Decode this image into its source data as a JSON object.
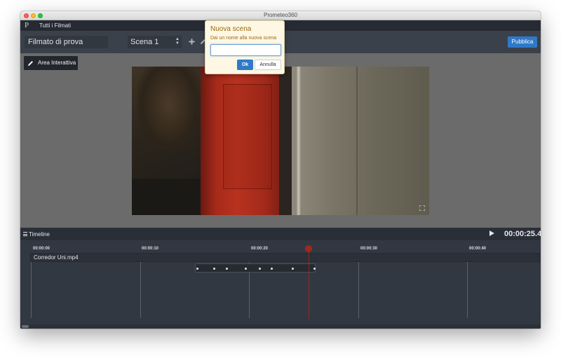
{
  "window": {
    "title": "Prometeo360"
  },
  "menubar": {
    "logo": "P",
    "all_films": "Tutti i Filmati"
  },
  "toolbar": {
    "film_title": "Filmato di prova",
    "scene_selected": "Scena 1",
    "add_icon": "plus-icon",
    "edit_icon": "pencil-icon",
    "delete_icon": "trash-icon",
    "publish_label": "Pubblica",
    "publish_color": "#2f79c8"
  },
  "stage": {
    "interactive_area_label": "Area Interattiva",
    "fullscreen_icon": "expand-icon"
  },
  "popover": {
    "title": "Nuova scena",
    "subtitle": "Dai un nome alla nuova scena",
    "input_value": "",
    "ok_label": "Ok",
    "cancel_label": "Annulla"
  },
  "timeline": {
    "label": "Timeline",
    "timecode": "00:00:25.4",
    "ruler": [
      "00:00:00",
      "00:00:10",
      "00:00:20",
      "00:00:30",
      "00:00:40"
    ],
    "track_name": "Corredor Uni.mp4",
    "playhead_color": "#a0281c"
  }
}
